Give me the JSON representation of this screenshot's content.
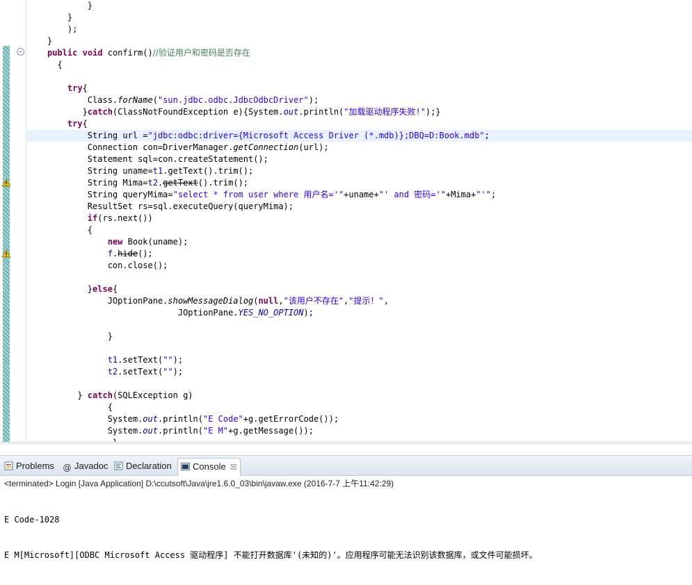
{
  "editor": {
    "lines": [
      {
        "parts": [
          [
            "        }",
            "p"
          ]
        ]
      },
      {
        "parts": [
          [
            "    }",
            "p"
          ]
        ]
      },
      {
        "parts": [
          [
            "    );",
            "p"
          ]
        ]
      },
      {
        "parts": [
          [
            "}",
            "p"
          ]
        ]
      },
      {
        "parts": [
          [
            "public",
            "kw"
          ],
          [
            " ",
            "p"
          ],
          [
            "void",
            "kw"
          ],
          [
            " confirm()",
            "p"
          ],
          [
            "//验证用户和密码是否存在",
            "cmt"
          ]
        ]
      },
      {
        "parts": [
          [
            "  {",
            "p"
          ]
        ]
      },
      {
        "parts": [
          [
            "",
            "p"
          ]
        ]
      },
      {
        "parts": [
          [
            "    ",
            "p"
          ],
          [
            "try",
            "kw"
          ],
          [
            "{",
            "p"
          ]
        ]
      },
      {
        "parts": [
          [
            "        Class.",
            "p"
          ],
          [
            "forName",
            "it"
          ],
          [
            "(",
            "p"
          ],
          [
            "\"sun.jdbc.odbc.JdbcOdbcDriver\"",
            "str"
          ],
          [
            ");",
            "p"
          ]
        ]
      },
      {
        "parts": [
          [
            "       }",
            "p"
          ],
          [
            "catch",
            "kw"
          ],
          [
            "(ClassNotFoundException e){System.",
            "p"
          ],
          [
            "out",
            "fld it"
          ],
          [
            ".println(",
            "p"
          ],
          [
            "\"加载驱动程序失败!\"",
            "str"
          ],
          [
            ");}",
            "p"
          ]
        ]
      },
      {
        "parts": [
          [
            "    ",
            "p"
          ],
          [
            "try",
            "kw"
          ],
          [
            "{",
            "p"
          ]
        ]
      },
      {
        "parts": [
          [
            "        String url =",
            "p"
          ],
          [
            "\"jdbc:odbc:driver={Microsoft Access Driver (*.mdb)};DBQ=D:Book.mdb\"",
            "str"
          ],
          [
            ";",
            "p"
          ]
        ],
        "current": true
      },
      {
        "parts": [
          [
            "        Connection con=DriverManager.",
            "p"
          ],
          [
            "getConnection",
            "it"
          ],
          [
            "(url);",
            "p"
          ]
        ]
      },
      {
        "parts": [
          [
            "        Statement sql=con.createStatement();",
            "p"
          ]
        ]
      },
      {
        "parts": [
          [
            "        String uname=",
            "p"
          ],
          [
            "t1",
            "fld"
          ],
          [
            ".getText().trim();",
            "p"
          ]
        ]
      },
      {
        "parts": [
          [
            "        String Mima=",
            "p"
          ],
          [
            "t2",
            "fld"
          ],
          [
            ".",
            "p"
          ],
          [
            "getText",
            "strike squig"
          ],
          [
            "().trim();",
            "p"
          ]
        ]
      },
      {
        "parts": [
          [
            "        String queryMima=",
            "p"
          ],
          [
            "\"select * from user where 用户名='\"",
            "str"
          ],
          [
            "+uname+",
            "p"
          ],
          [
            "\"' and 密码='\"",
            "str"
          ],
          [
            "+Mima+",
            "p"
          ],
          [
            "\"'\"",
            "str"
          ],
          [
            ";",
            "p"
          ]
        ]
      },
      {
        "parts": [
          [
            "        ResultSet rs=sql.executeQuery(queryMima);",
            "p"
          ]
        ]
      },
      {
        "parts": [
          [
            "        ",
            "p"
          ],
          [
            "if",
            "kw"
          ],
          [
            "(rs.next())",
            "p"
          ]
        ]
      },
      {
        "parts": [
          [
            "        {",
            "p"
          ]
        ]
      },
      {
        "parts": [
          [
            "            ",
            "p"
          ],
          [
            "new",
            "kw"
          ],
          [
            " Book(uname);",
            "p"
          ]
        ]
      },
      {
        "parts": [
          [
            "            ",
            "p"
          ],
          [
            "f",
            "fld"
          ],
          [
            ".",
            "p"
          ],
          [
            "hide",
            "strike squig"
          ],
          [
            "();",
            "p"
          ]
        ]
      },
      {
        "parts": [
          [
            "            con.close();",
            "p"
          ]
        ]
      },
      {
        "parts": [
          [
            "",
            "p"
          ]
        ]
      },
      {
        "parts": [
          [
            "        }",
            "p"
          ],
          [
            "else",
            "kw"
          ],
          [
            "{",
            "p"
          ]
        ]
      },
      {
        "parts": [
          [
            "            JOptionPane.",
            "p"
          ],
          [
            "showMessageDialog",
            "it"
          ],
          [
            "(",
            "p"
          ],
          [
            "null",
            "kw"
          ],
          [
            ",",
            "p"
          ],
          [
            "\"该用户不存在\"",
            "str"
          ],
          [
            ",",
            "p"
          ],
          [
            "\"提示！\"",
            "str"
          ],
          [
            ",",
            "p"
          ]
        ]
      },
      {
        "parts": [
          [
            "                          JOptionPane.",
            "p"
          ],
          [
            "YES_NO_OPTION",
            "fld it"
          ],
          [
            ");",
            "p"
          ]
        ]
      },
      {
        "parts": [
          [
            "",
            "p"
          ]
        ]
      },
      {
        "parts": [
          [
            "            }",
            "p"
          ]
        ]
      },
      {
        "parts": [
          [
            "",
            "p"
          ]
        ]
      },
      {
        "parts": [
          [
            "            ",
            "p"
          ],
          [
            "t1",
            "fld"
          ],
          [
            ".setText(",
            "p"
          ],
          [
            "\"\"",
            "str"
          ],
          [
            ");",
            "p"
          ]
        ]
      },
      {
        "parts": [
          [
            "            ",
            "p"
          ],
          [
            "t2",
            "fld"
          ],
          [
            ".setText(",
            "p"
          ],
          [
            "\"\"",
            "str"
          ],
          [
            ");",
            "p"
          ]
        ]
      },
      {
        "parts": [
          [
            "",
            "p"
          ]
        ]
      },
      {
        "parts": [
          [
            "      } ",
            "p"
          ],
          [
            "catch",
            "kw"
          ],
          [
            "(SQLException g)",
            "p"
          ]
        ]
      },
      {
        "parts": [
          [
            "            {",
            "p"
          ]
        ]
      },
      {
        "parts": [
          [
            "            System.",
            "p"
          ],
          [
            "out",
            "fld it"
          ],
          [
            ".println(",
            "p"
          ],
          [
            "\"E Code\"",
            "str"
          ],
          [
            "+g.getErrorCode());",
            "p"
          ]
        ]
      },
      {
        "parts": [
          [
            "            System.",
            "p"
          ],
          [
            "out",
            "fld it"
          ],
          [
            ".println(",
            "p"
          ],
          [
            "\"E M\"",
            "str"
          ],
          [
            "+g.getMessage());",
            "p"
          ]
        ]
      },
      {
        "parts": [
          [
            "             }",
            "p"
          ]
        ]
      }
    ],
    "colors": {
      "keyword": "#7f0055",
      "string": "#2a00ff",
      "comment": "#3f7f5f",
      "field": "#0000c0",
      "current_line": "#e8f2fe"
    }
  },
  "views": {
    "tabs": [
      {
        "label": "Problems",
        "icon": "problems-icon"
      },
      {
        "label": "Javadoc",
        "icon": "javadoc-icon"
      },
      {
        "label": "Declaration",
        "icon": "declaration-icon"
      },
      {
        "label": "Console",
        "icon": "console-icon",
        "active": true
      }
    ],
    "close_glyph": "☒",
    "status": "<terminated> Login [Java Application] D:\\ccutsoft\\Java\\jre1.6.0_03\\bin\\javaw.exe (2016-7-7 上午11:42:29)",
    "output": [
      "E Code-1028",
      "E M[Microsoft][ODBC Microsoft Access 驱动程序] 不能打开数据库'(未知的)'。应用程序可能无法识别该数据库，或文件可能损坏。"
    ]
  }
}
